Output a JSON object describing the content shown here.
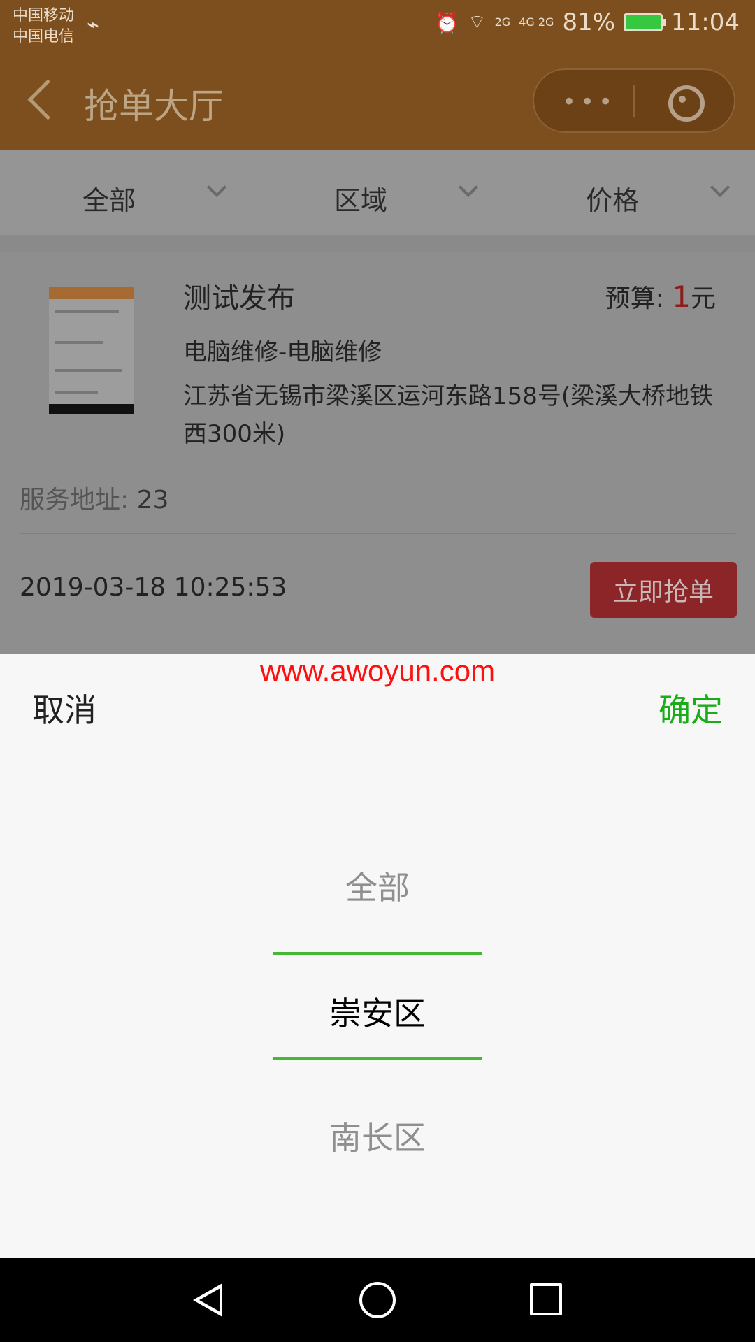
{
  "status_bar": {
    "carrier_1": "中国移动",
    "carrier_2": "中国电信",
    "usb_icon": "usb-icon",
    "alarm_icon": "alarm-icon",
    "wifi_icon": "wifi-icon",
    "signal_1_label": "2G",
    "signal_2_label": "4G 2G",
    "battery": "81%",
    "time": "11:04"
  },
  "nav": {
    "title": "抢单大厅",
    "back_icon": "back-icon",
    "more_icon": "more-icon",
    "target_icon": "target-icon"
  },
  "filters": [
    {
      "label": "全部"
    },
    {
      "label": "区域"
    },
    {
      "label": "价格"
    }
  ],
  "order": {
    "title": "测试发布",
    "budget_label": "预算: ",
    "budget_value": "1",
    "budget_unit": "元",
    "category": "电脑维修-电脑维修",
    "address": "江苏省无锡市梁溪区运河东路158号(梁溪大桥地铁西300米)",
    "service_label": "服务地址: ",
    "service_value": "23",
    "time": "2019-03-18 10:25:53",
    "button": "立即抢单"
  },
  "sheet": {
    "watermark": "www.awoyun.com",
    "cancel": "取消",
    "confirm": "确定",
    "options": [
      "全部",
      "崇安区",
      "南长区"
    ]
  },
  "colors": {
    "header": "#7d4f1e",
    "accent_green": "#1aad19",
    "picker_green": "#46b735",
    "budget_red": "#8d1d1d",
    "watermark_red": "#ff1010"
  }
}
